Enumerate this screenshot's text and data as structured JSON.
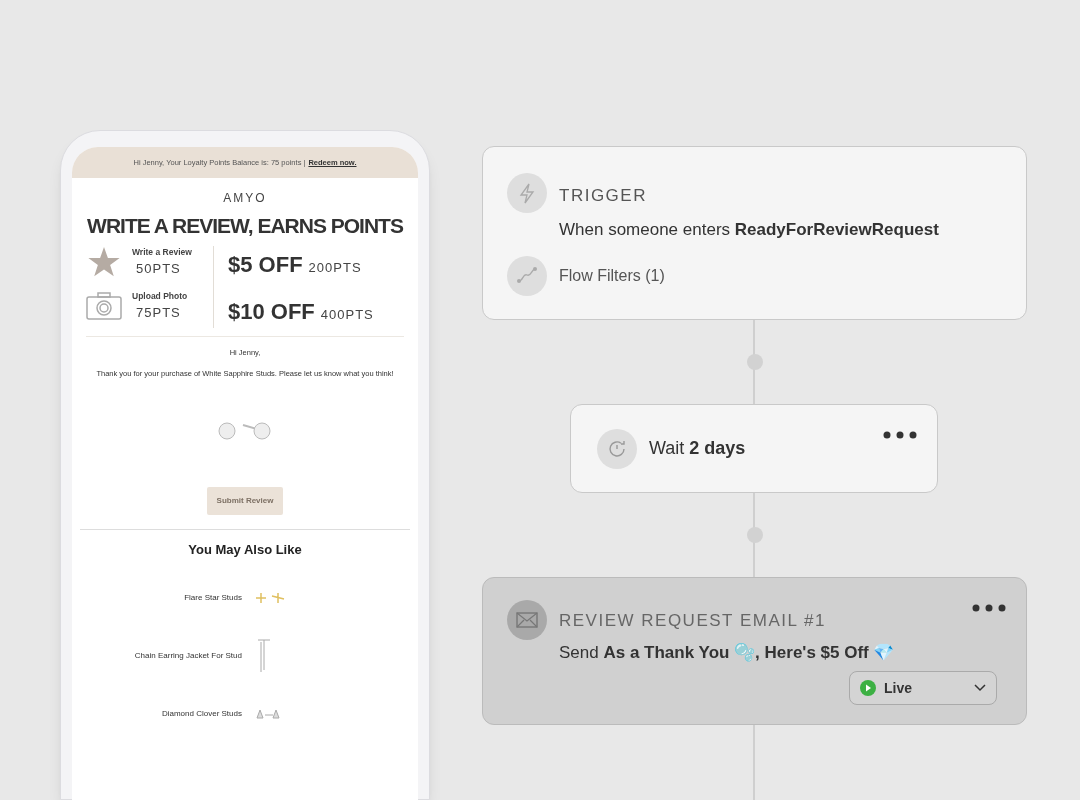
{
  "email_preview": {
    "banner": "Hi Jenny, Your Loyalty Points Balance is: 75 points | ",
    "banner_link": "Redeem now.",
    "brand": "AMYO",
    "headline": "WRITE A REVIEW, EARNS POINTS",
    "earn_items": [
      {
        "kind": "star",
        "label": "Write a Review",
        "points": "50PTS"
      },
      {
        "kind": "camera",
        "label": "Upload Photo",
        "points": "75PTS"
      }
    ],
    "rewards": [
      {
        "amount": "$5 OFF",
        "points": "200PTS"
      },
      {
        "amount": "$10 OFF",
        "points": "400PTS"
      }
    ],
    "greeting": "Hi Jenny,",
    "message": "Thank you for your purchase of White Sapphire Studs. Please let us know what you think!",
    "submit_button": "Submit Review",
    "recommendations_title": "You May Also Like",
    "products": [
      {
        "name": "Flare Star Studs",
        "kind": "star"
      },
      {
        "name": "Chain Earring Jacket For Stud",
        "kind": "chain"
      },
      {
        "name": "Diamond Clover Studs",
        "kind": "clover"
      }
    ]
  },
  "flow": [
    {
      "kind": "trigger",
      "label": "TRIGGER",
      "text": "When someone enters **ReadyForReviewRequest**",
      "filter": "Flow Filters (1)"
    },
    {
      "kind": "wait",
      "text": "Wait **2 days**"
    },
    {
      "kind": "email",
      "label": "REVIEW REQUEST EMAIL #1",
      "text": "Send **As a Thank You 🫧, Here's $5 Off** 💎",
      "status": "Live"
    }
  ]
}
